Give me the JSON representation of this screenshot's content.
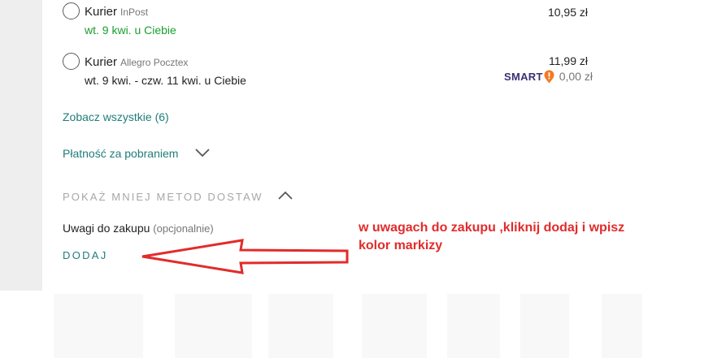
{
  "delivery_options": [
    {
      "carrier": "Kurier",
      "service": "InPost",
      "eta": "wt. 9 kwi. u Ciebie",
      "price": "10,95 zł"
    },
    {
      "carrier": "Kurier",
      "service": "Allegro Pocztex",
      "eta": "wt. 9 kwi. - czw. 11 kwi. u Ciebie",
      "price": "11,99 zł",
      "smart_logo": "SMART",
      "smart_price": "0,00 zł"
    }
  ],
  "see_all_label": "Zobacz wszystkie (6)",
  "cod_label": "Płatność za pobraniem",
  "show_less_label": "POKAŻ MNIEJ METOD DOSTAW",
  "remarks": {
    "label": "Uwagi do zakupu",
    "optional": "(opcjonalnie)",
    "add_label": "DODAJ"
  },
  "annotation": {
    "text": "w uwagach do zakupu ,kliknij dodaj i wpisz kolor markizy"
  },
  "colors": {
    "accent_teal": "#1f7d7a",
    "eta_green": "#1a9e2f",
    "annotation_red": "#e22b2b",
    "smart_purple": "#3d2f74",
    "smart_orange": "#f47920"
  },
  "icons": [
    "radio-unchecked-icon",
    "chevron-down-icon",
    "chevron-up-icon",
    "smart-badge-icon",
    "red-arrow-left"
  ]
}
